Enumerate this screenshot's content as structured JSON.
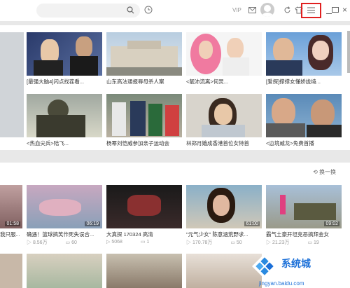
{
  "topbar": {
    "vip_label": "VIP",
    "icons": [
      "search-icon",
      "clock-icon",
      "mail-icon",
      "avatar",
      "refresh-icon",
      "shirt-icon",
      "menu-icon",
      "minimize-icon",
      "maximize-icon",
      "close-icon"
    ],
    "close_glyph": "×"
  },
  "section1": {
    "items": [
      {
        "caption": "[最强大脑4]闪点找茬看..."
      },
      {
        "caption": "山东高法通报辱母杀人案"
      },
      {
        "caption": "<靓沛流离>何炅..."
      },
      {
        "caption": "[爱探]撑撑女懂娇拢绮..."
      },
      {
        "caption": "<热血尖兵>陆飞..."
      },
      {
        "caption": "杨幂刘恺威参加亲子运动会"
      },
      {
        "caption": "林郑月娥成香港首位女特首"
      },
      {
        "caption": "<边境威龙>免费首播"
      }
    ]
  },
  "section2": {
    "refresh_label": "换一换",
    "items": [
      {
        "caption": "我只服...",
        "duration": "01:58",
        "views": "",
        "comments": ""
      },
      {
        "caption": "确遇！篮球搞笑作死失误合...",
        "duration": "06:19",
        "views": "8.56万",
        "comments": "60"
      },
      {
        "caption": "大真探 170324 高清",
        "duration": "",
        "views": "5068",
        "comments": "1"
      },
      {
        "caption": "\"元气少女\" 陈意涵荒野求...",
        "duration": "61:00",
        "views": "170.78万",
        "comments": "50"
      },
      {
        "caption": "霸气土豪开坦克恶搞拜金女",
        "duration": "09:02",
        "views": "21.23万",
        "comments": "19"
      }
    ]
  },
  "watermark": {
    "text": "系统城",
    "url": "jingyan.baidu.com"
  },
  "colors": {
    "highlight": "#e02020",
    "watermark_blue": "#1a6fd8"
  }
}
